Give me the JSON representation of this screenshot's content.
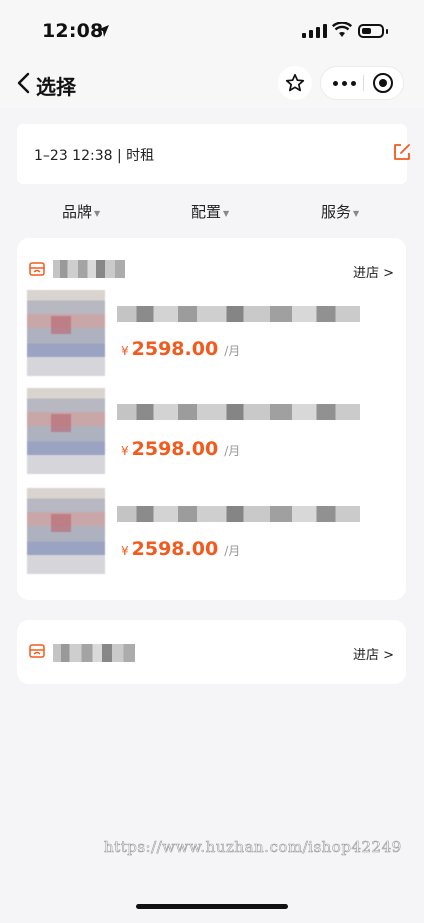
{
  "status": {
    "time": "12:08"
  },
  "nav": {
    "title": "选择"
  },
  "time_bar": {
    "text": "1–23 12:38 | 时租"
  },
  "filters": [
    {
      "label": "品牌"
    },
    {
      "label": "配置"
    },
    {
      "label": "服务"
    }
  ],
  "stores": [
    {
      "enter_label": "进店 >",
      "products": [
        {
          "currency": "¥",
          "price": "2598.00",
          "unit": "/月"
        },
        {
          "currency": "¥",
          "price": "2598.00",
          "unit": "/月"
        },
        {
          "currency": "¥",
          "price": "2598.00",
          "unit": "/月"
        }
      ]
    },
    {
      "enter_label": "进店 >",
      "products": []
    }
  ],
  "watermark": "https://www.huzhan.com/ishop42249",
  "colors": {
    "accent": "#f25a1e",
    "background": "#f5f5f7"
  }
}
